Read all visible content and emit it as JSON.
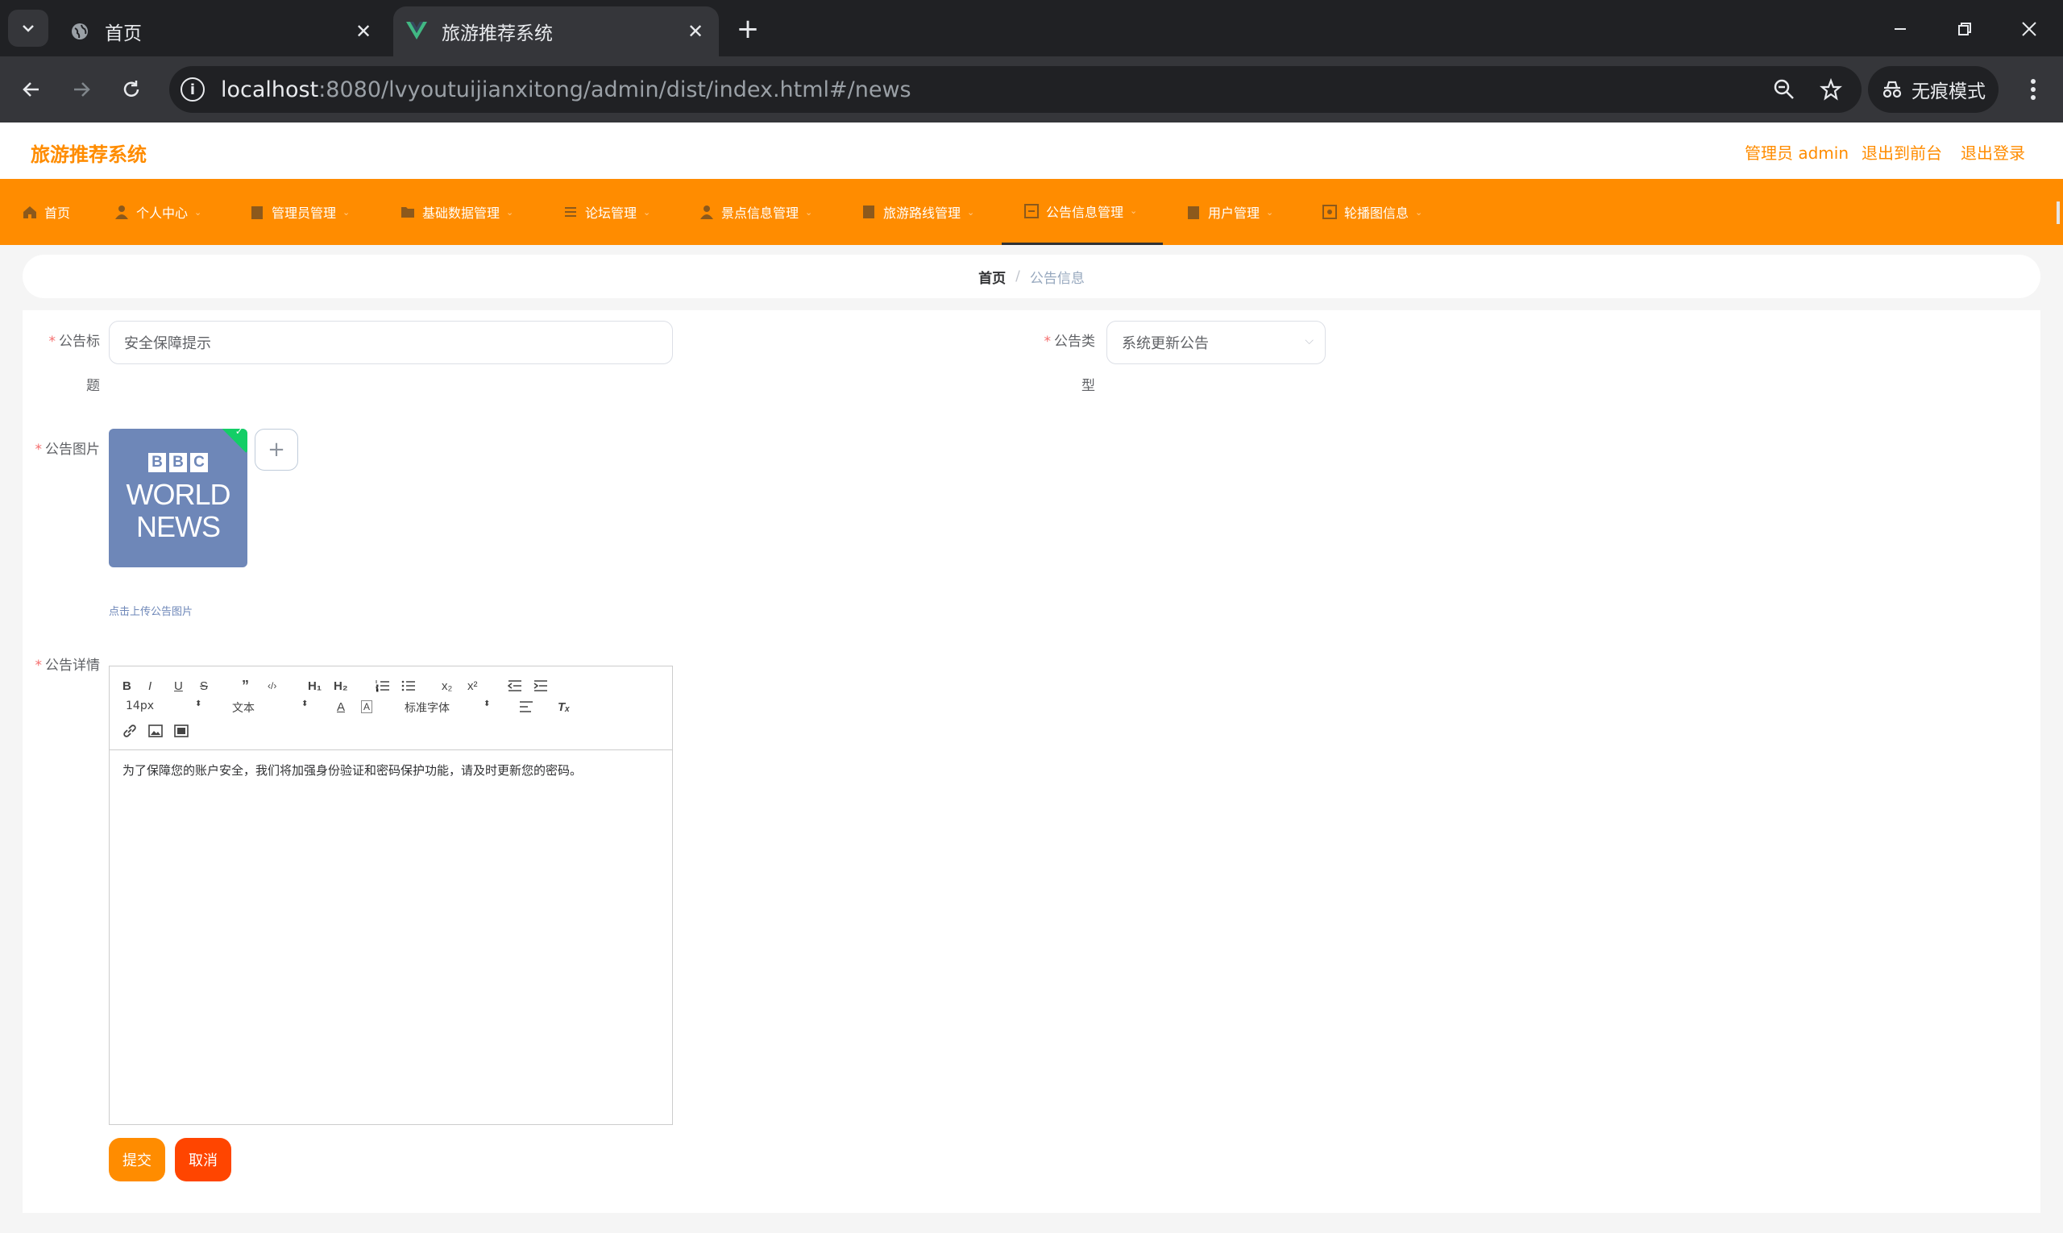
{
  "browser": {
    "tabs": [
      {
        "title": "首页",
        "favicon": "globe-icon"
      },
      {
        "title": "旅游推荐系统",
        "favicon": "vue-logo-icon"
      }
    ],
    "url_host": "localhost",
    "url_rest": ":8080/lvyoutuijianxitong/admin/dist/index.html#/news",
    "incognito_label": "无痕模式"
  },
  "header": {
    "title": "旅游推荐系统",
    "user_label": "管理员 admin",
    "to_front": "退出到前台",
    "logout": "退出登录"
  },
  "menu": {
    "items": [
      {
        "label": "首页",
        "icon": "home-icon"
      },
      {
        "label": "个人中心",
        "icon": "user-icon"
      },
      {
        "label": "管理员管理",
        "icon": "clipboard-icon"
      },
      {
        "label": "基础数据管理",
        "icon": "folder-icon"
      },
      {
        "label": "论坛管理",
        "icon": "list-icon"
      },
      {
        "label": "景点信息管理",
        "icon": "person-icon"
      },
      {
        "label": "旅游路线管理",
        "icon": "book-icon"
      },
      {
        "label": "公告信息管理",
        "icon": "notice-icon"
      },
      {
        "label": "用户管理",
        "icon": "clipboard-icon"
      },
      {
        "label": "轮播图信息",
        "icon": "image-icon"
      }
    ],
    "active_index": 7
  },
  "breadcrumb": {
    "home": "首页",
    "separator": "/",
    "current": "公告信息"
  },
  "form": {
    "title_label_1": "公告标",
    "title_label_2": "题",
    "title_value": "安全保障提示",
    "type_label_1": "公告类",
    "type_label_2": "型",
    "type_value": "系统更新公告",
    "image_label": "公告图片",
    "image_lines": [
      "BBC",
      "WORLD",
      "NEWS"
    ],
    "upload_tip": "点击上传公告图片",
    "detail_label": "公告详情",
    "editor": {
      "font_size": "14px",
      "header_select": "文本",
      "font_family": "标准字体",
      "content": "为了保障您的账户安全，我们将加强身份验证和密码保护功能，请及时更新您的密码。"
    },
    "submit": "提交",
    "cancel": "取消"
  },
  "colors": {
    "accent": "#ff8c00",
    "cancel": "#ff4500",
    "required": "#f56c6c",
    "upload_success": "#13ce66"
  }
}
